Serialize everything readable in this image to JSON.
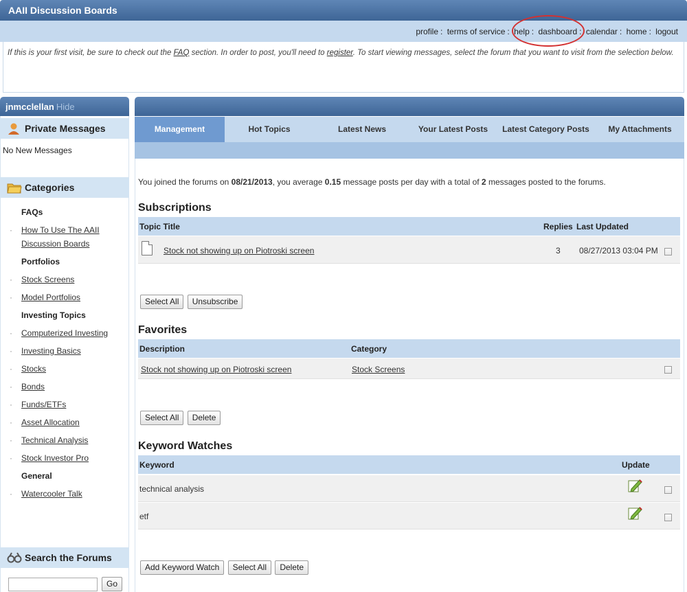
{
  "header": {
    "title": "AAII Discussion Boards"
  },
  "nav": {
    "links": [
      "profile",
      "terms of service",
      "help",
      "dashboard",
      "calendar",
      "home",
      "logout"
    ],
    "separator": ":"
  },
  "notice": {
    "part1": "If this is your first visit, be sure to check out the ",
    "faq_link": "FAQ",
    "part2": " section. In order to post, you'll need to ",
    "register_link": "register",
    "part3": ". To start viewing messages, select the forum that you want to visit from the selection below."
  },
  "sidebar": {
    "username": "jnmcclellan",
    "hide_label": "Hide",
    "private_messages": {
      "title": "Private Messages",
      "icon": "person-icon",
      "status": "No New Messages"
    },
    "categories": {
      "title": "Categories",
      "icon": "folder-icon",
      "groups": [
        {
          "name": "FAQs",
          "links": [
            "How To Use The AAII Discussion Boards"
          ]
        },
        {
          "name": "Portfolios",
          "links": [
            "Stock Screens",
            "Model Portfolios"
          ]
        },
        {
          "name": "Investing Topics",
          "links": [
            "Computerized Investing",
            "Investing Basics",
            "Stocks",
            "Bonds",
            "Funds/ETFs",
            "Asset Allocation",
            "Technical Analysis",
            "Stock Investor Pro"
          ]
        },
        {
          "name": "General",
          "links": [
            "Watercooler Talk"
          ]
        }
      ]
    },
    "search": {
      "title": "Search the Forums",
      "icon": "binoculars-icon",
      "input_value": "",
      "go_label": "Go"
    }
  },
  "tabs": [
    "Management",
    "Hot Topics",
    "Latest News",
    "Your Latest Posts",
    "Latest Category Posts",
    "My Attachments"
  ],
  "stats": {
    "prefix": "You joined the forums on ",
    "join_date": "08/21/2013",
    "mid1": ", you average ",
    "avg_posts": "0.15",
    "mid2": " message posts per day with a total of ",
    "total": "2",
    "suffix": " messages posted to the forums."
  },
  "subscriptions": {
    "title": "Subscriptions",
    "columns": [
      "Topic Title",
      "Replies",
      "Last Updated"
    ],
    "rows": [
      {
        "topic": "Stock not showing up on Piotroski screen",
        "replies": "3",
        "last_updated": "08/27/2013 03:04 PM"
      }
    ],
    "buttons": [
      "Select All",
      "Unsubscribe"
    ]
  },
  "favorites": {
    "title": "Favorites",
    "columns": [
      "Description",
      "Category"
    ],
    "rows": [
      {
        "description": "Stock not showing up on Piotroski screen",
        "category": "Stock Screens"
      }
    ],
    "buttons": [
      "Select All",
      "Delete"
    ]
  },
  "keyword_watches": {
    "title": "Keyword Watches",
    "columns": [
      "Keyword",
      "Update"
    ],
    "rows": [
      {
        "keyword": "technical analysis"
      },
      {
        "keyword": "etf"
      }
    ],
    "buttons": [
      "Add Keyword Watch",
      "Select All",
      "Delete"
    ]
  },
  "colors": {
    "header_blue": "#3e6596",
    "light_blue": "#c5d9ee",
    "active_tab": "#6f9ad0",
    "annotation_red": "#d33030"
  }
}
